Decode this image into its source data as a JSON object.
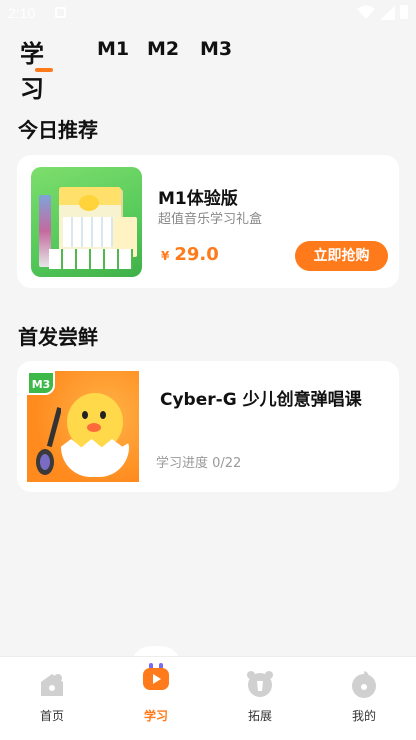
{
  "status_bar": {
    "time": "2:10"
  },
  "tabs": {
    "active": "学习",
    "m1": "M1",
    "m2": "M2",
    "m3": "M3"
  },
  "today": {
    "section_title": "今日推荐",
    "product": {
      "title": "M1体验版",
      "subtitle": "超值音乐学习礼盒",
      "currency": "¥",
      "price": "29.0",
      "buy_label": "立即抢购"
    }
  },
  "debut": {
    "section_title": "首发尝鲜",
    "course": {
      "badge": "M3",
      "title": "Cyber-G 少儿创意弹唱课",
      "progress": "学习进度 0/22"
    }
  },
  "bottom_nav": [
    {
      "label": "首页",
      "icon": "home-icon"
    },
    {
      "label": "学习",
      "icon": "study-icon",
      "active": true
    },
    {
      "label": "拓展",
      "icon": "expand-icon"
    },
    {
      "label": "我的",
      "icon": "profile-icon"
    }
  ],
  "colors": {
    "accent": "#ff7a1a",
    "background": "#f5f5f5",
    "badge_green": "#3fb84a"
  }
}
